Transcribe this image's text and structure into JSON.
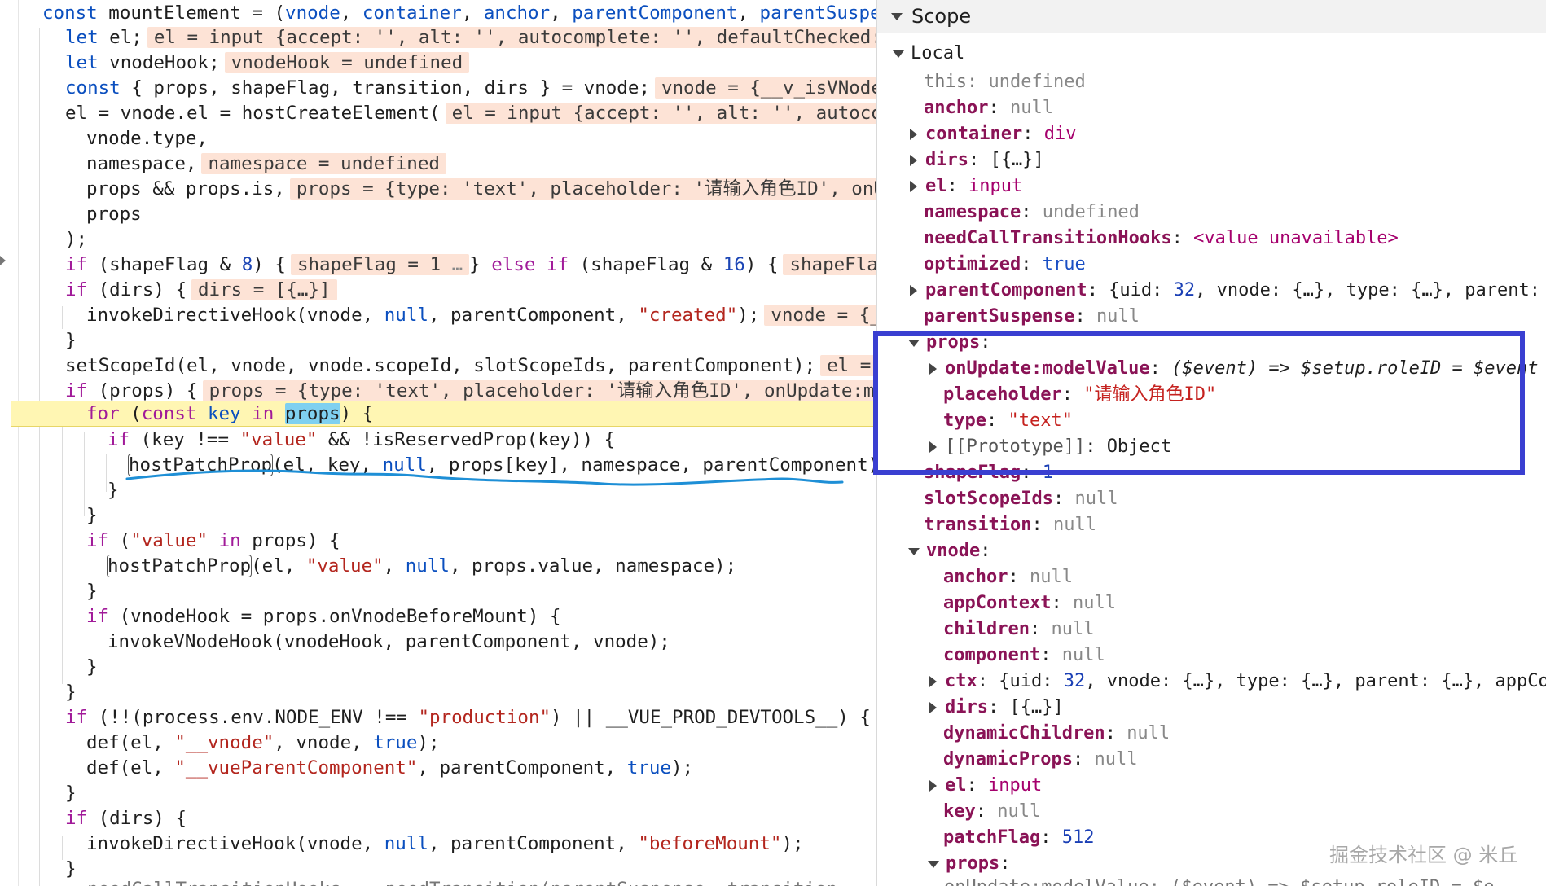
{
  "code": {
    "lines": [
      "const mountElement = (vnode, container, anchor, parentComponent, parentSuspen",
      "let el;",
      "let vnodeHook;",
      "const { props, shapeFlag, transition, dirs } = vnode;",
      "el = vnode.el = hostCreateElement(",
      "vnode.type,",
      "namespace,",
      "props && props.is,",
      "props",
      ");",
      "if (shapeFlag & 8) {",
      "} else if (shapeFlag & 16) {",
      "if (dirs) {",
      "invokeDirectiveHook(vnode, null, parentComponent, \"created\");",
      "}",
      "setScopeId(el, vnode, vnode.scopeId, slotScopeIds, parentComponent);",
      "if (props) {",
      "for (const key in props) {",
      "if (key !== \"value\" && !isReservedProp(key)) {",
      "hostPatchProp(el, key, null, props[key], namespace, parentComponent);",
      "}",
      "}",
      "if (\"value\" in props) {",
      "hostPatchProp(el, \"value\", null, props.value, namespace);",
      "}",
      "if (vnodeHook = props.onVnodeBeforeMount) {",
      "invokeVNodeHook(vnodeHook, parentComponent, vnode);",
      "}",
      "}",
      "if (!!(process.env.NODE_ENV !== \"production\") || __VUE_PROD_DEVTOOLS__) {",
      "def(el, \"__vnode\", vnode, true);",
      "def(el, \"__vueParentComponent\", parentComponent, true);",
      "}",
      "if (dirs) {",
      "invokeDirectiveHook(vnode, null, parentComponent, \"beforeMount\");",
      "}"
    ],
    "inline_values": {
      "el": "el = input {accept: '', alt: '', autocomplete: '', defaultChecked:",
      "vnodeHook": "vnodeHook = undefined",
      "vnode": "vnode = {__v_isVNode",
      "el_create": "el = input {accept: '', alt: '', autoco",
      "namespace": "namespace = undefined",
      "props_is": "props = {type: 'text', placeholder: '请输入角色ID', onU",
      "shapeFlag": "shapeFlag = 1",
      "shapeFlag_cut": "shapeFla",
      "dirs": "dirs = [{…}]",
      "vnode_created": "vnode = {_",
      "el_scope": "el =",
      "props_if": "props = {type: 'text', placeholder: '请输入角色ID', onUpdate:m",
      "ellipsis": "…"
    },
    "bottom_partial": "__needCallTransitionHooks  = needTransition(parentSuspense, transition"
  },
  "scope": {
    "title": "Scope",
    "local_label": "Local",
    "rows": {
      "this_key": "this",
      "this_val": "undefined",
      "anchor_key": "anchor",
      "anchor_val": "null",
      "container_key": "container",
      "container_val": "div",
      "dirs_key": "dirs",
      "dirs_val": "[{…}]",
      "el_key": "el",
      "el_val": "input",
      "namespace_key": "namespace",
      "namespace_val": "undefined",
      "nct_key": "needCallTransitionHooks",
      "nct_val": "<value unavailable>",
      "optimized_key": "optimized",
      "optimized_val": "true",
      "pc_key": "parentComponent",
      "pc_val_a": "{uid: ",
      "pc_val_num": "32",
      "pc_val_b": ", vnode: {…}, type: {…}, parent:",
      "ps_key": "parentSuspense",
      "ps_val": "null",
      "props_key": "props",
      "onupdate_key": "onUpdate:modelValue",
      "onupdate_val": "($event) => $setup.roleID = $event",
      "placeholder_key": "placeholder",
      "placeholder_val": "\"请输入角色ID\"",
      "type_key": "type",
      "type_val": "\"text\"",
      "proto_key": "[[Prototype]]",
      "proto_val": "Object",
      "shapeflag_key": "shapeFlag",
      "shapeflag_val": "1",
      "ssi_key": "slotScopeIds",
      "ssi_val": "null",
      "transition_key": "transition",
      "transition_val": "null",
      "vnode_key": "vnode",
      "v_anchor_key": "anchor",
      "v_anchor_val": "null",
      "v_appctx_key": "appContext",
      "v_appctx_val": "null",
      "v_children_key": "children",
      "v_children_val": "null",
      "v_component_key": "component",
      "v_component_val": "null",
      "v_ctx_key": "ctx",
      "v_ctx_a": "{uid: ",
      "v_ctx_num": "32",
      "v_ctx_b": ", vnode: {…}, type: {…}, parent: {…}, appCo",
      "v_dirs_key": "dirs",
      "v_dirs_val": "[{…}]",
      "v_dc_key": "dynamicChildren",
      "v_dc_val": "null",
      "v_dp_key": "dynamicProps",
      "v_dp_val": "null",
      "v_el_key": "el",
      "v_el_val": "input",
      "v_key_key": "key",
      "v_key_val": "null",
      "v_pf_key": "patchFlag",
      "v_pf_val": "512",
      "v_props_key": "props",
      "v_props_partial": "onUpdate:modelValue: ($event) => $setup.roleID = $e"
    }
  },
  "watermark": "掘金技术社区 @ 米丘",
  "colors": {
    "highlight_box": "#3a3fd1",
    "paused_line": "#fff6b3",
    "inline_value_bg": "#fde3d6",
    "squiggle": "#1e8fd6"
  }
}
